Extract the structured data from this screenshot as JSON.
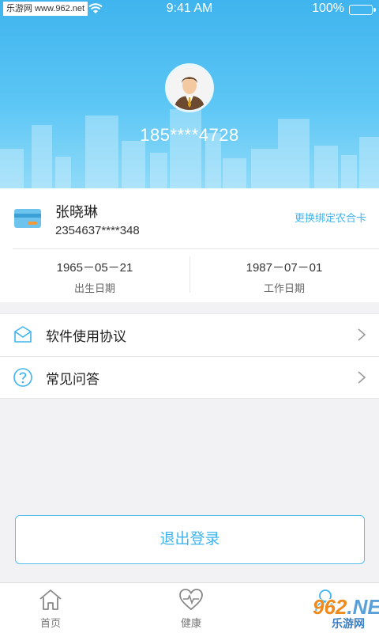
{
  "status_bar": {
    "carrier": "乐游网 www.962.net",
    "time": "9:41 AM",
    "battery": "100%"
  },
  "header": {
    "phone": "185****4728"
  },
  "profile": {
    "name": "张晓琳",
    "card_number": "2354637****348",
    "change_card_link": "更换绑定农合卡",
    "birth_date": "1965－05－21",
    "birth_label": "出生日期",
    "work_date": "1987－07－01",
    "work_label": "工作日期"
  },
  "menu": {
    "items": [
      {
        "label": "软件使用协议",
        "icon": "agreement-icon"
      },
      {
        "label": "常见问答",
        "icon": "question-icon"
      }
    ]
  },
  "logout_label": "退出登录",
  "tabbar": {
    "tabs": [
      {
        "label": "首页",
        "icon": "home-icon"
      },
      {
        "label": "健康",
        "icon": "health-icon"
      },
      {
        "label": "",
        "icon": "profile-icon"
      }
    ]
  },
  "watermark": {
    "number": "962",
    "suffix": ".NET",
    "text": "乐游网"
  },
  "colors": {
    "accent": "#3fb4ee",
    "background": "#f2f2f4"
  }
}
